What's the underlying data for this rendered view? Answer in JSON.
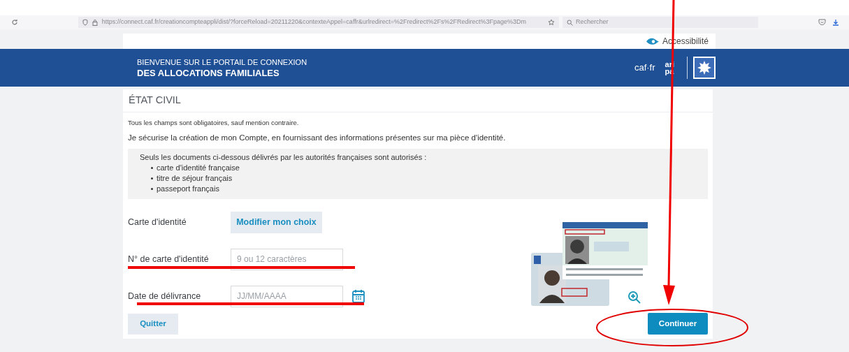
{
  "browser": {
    "url": "https://connect.caf.fr/creationcompteappli/dist/?forceReload=20211220&contexteAppel=caffr&urlredirect=%2Fredirect%2Fs%2FRedirect%3Fpage%3Dm",
    "search_placeholder": "Rechercher"
  },
  "top_link": "Accessibilité",
  "header": {
    "line1": "BIENVENUE SUR LE PORTAIL DE CONNEXION",
    "line2": "DES ALLOCATIONS FAMILIALES",
    "logo_text": "caf·fr",
    "aripa_top": "ari",
    "aripa_bottom": "pa"
  },
  "section": {
    "title": "ÉTAT CIVIL",
    "note": "Tous les champs sont obligatoires, sauf mention contraire.",
    "intro": "Je sécurise la création de mon Compte, en fournissant des informations présentes sur ma pièce d'identité.",
    "info": {
      "lead": "Seuls les documents ci-dessous délivrés par les autorités françaises sont autorisés :",
      "items": [
        "carte d'identité française",
        "titre de séjour français",
        "passeport français"
      ]
    }
  },
  "form": [
    {
      "kind": "choice",
      "label": "Carte d'identité",
      "button": "Modifier mon choix"
    },
    {
      "kind": "text",
      "label": "N° de carte d'identité",
      "placeholder": "9 ou 12 caractères"
    },
    {
      "kind": "date",
      "label": "Date de délivrance",
      "placeholder": "JJ/MM/AAAA"
    }
  ],
  "buttons": {
    "quit": "Quitter",
    "continue": "Continuer"
  }
}
